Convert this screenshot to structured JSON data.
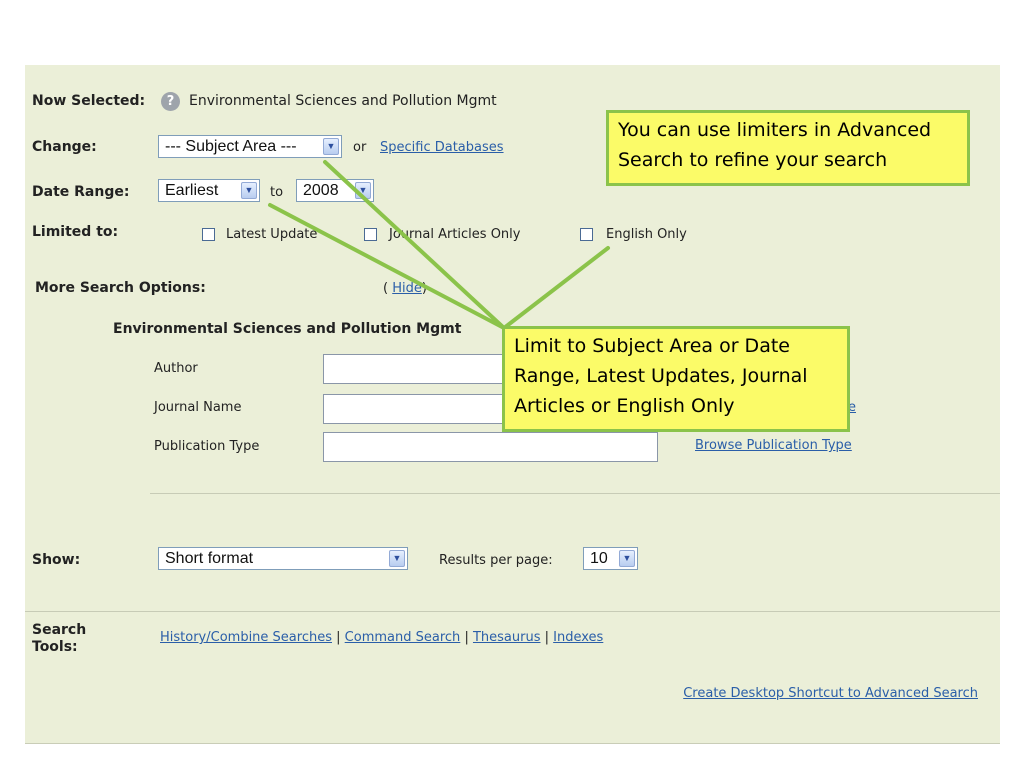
{
  "now_selected": {
    "label": "Now Selected:",
    "value": "Environmental Sciences and Pollution Mgmt"
  },
  "change": {
    "label": "Change:",
    "select_value": "--- Subject Area ---",
    "or_text": "or",
    "link": "Specific Databases"
  },
  "date_range": {
    "label": "Date Range:",
    "from": "Earliest",
    "to_text": "to",
    "to_value": "2008"
  },
  "limited_to": {
    "label": "Limited to:",
    "options": [
      {
        "label": "Latest Update",
        "checked": false
      },
      {
        "label": "Journal Articles Only",
        "checked": false
      },
      {
        "label": "English Only",
        "checked": false
      }
    ]
  },
  "more_options": {
    "label": "More Search Options:",
    "hide_open": "(",
    "hide_link": "Hide",
    "hide_close": ")",
    "section_title": "Environmental Sciences and Pollution Mgmt",
    "fields": [
      {
        "label": "Author",
        "value": "",
        "browse": ""
      },
      {
        "label": "Journal Name",
        "value": "",
        "browse": "e"
      },
      {
        "label": "Publication Type",
        "value": "",
        "browse": "Browse Publication Type"
      }
    ]
  },
  "show": {
    "label": "Show:",
    "format": "Short format",
    "results_label": "Results per page:",
    "results_value": "10"
  },
  "search_tools": {
    "label_line1": "Search",
    "label_line2": "Tools:",
    "links": [
      "History/Combine Searches",
      "Command Search",
      "Thesaurus",
      "Indexes"
    ],
    "separator": "|",
    "shortcut": "Create Desktop Shortcut to Advanced Search"
  },
  "callouts": {
    "top": {
      "line1": "You can use limiters in Advanced",
      "line2": "Search to refine your search"
    },
    "bottom": {
      "line1": "Limit to Subject Area or Date",
      "line2": "Range, Latest Updates, Journal",
      "line3": "Articles or English Only"
    }
  },
  "colors": {
    "panel_bg": "#ebefd8",
    "link": "#2a5ea8",
    "callout_bg": "#fbfb68",
    "callout_border": "#8bc34a"
  },
  "icons": {
    "help": "question-circle-icon",
    "dropdown": "chevron-down-icon"
  }
}
